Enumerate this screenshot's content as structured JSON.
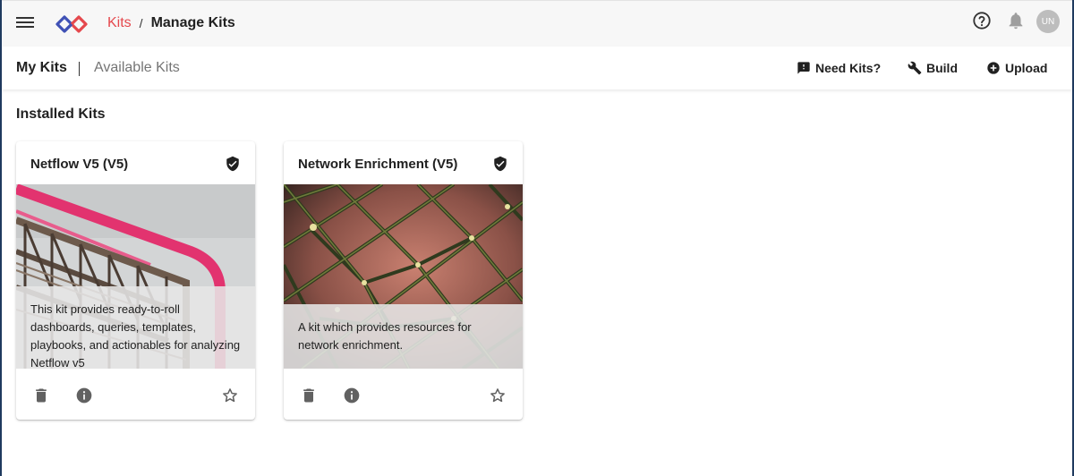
{
  "header": {
    "breadcrumb": {
      "parent": "Kits",
      "separator": "/",
      "current": "Manage Kits"
    },
    "avatar_initials": "UN",
    "icons": [
      "menu-icon",
      "help-icon",
      "bell-icon"
    ]
  },
  "subnav": {
    "tabs": [
      {
        "label": "My Kits",
        "active": true
      },
      {
        "label": "Available Kits",
        "active": false
      }
    ],
    "actions": [
      {
        "label": "Need Kits?",
        "icon": "feedback-icon"
      },
      {
        "label": "Build",
        "icon": "wrench-icon"
      },
      {
        "label": "Upload",
        "icon": "add-circle-icon"
      }
    ]
  },
  "main": {
    "section_title": "Installed Kits",
    "kits": [
      {
        "title": "Netflow V5 (V5)",
        "description": "This kit provides ready-to-roll dashboards, queries, templates, playbooks, and actionables for analyzing Netflow v5",
        "verified": true,
        "image": "industrial-pipes-photo"
      },
      {
        "title": "Network Enrichment (V5)",
        "description": "A kit which provides resources for network enrichment.",
        "verified": true,
        "image": "rope-net-photo"
      }
    ]
  },
  "colors": {
    "accent_red": "#e5484d",
    "logo_blue": "#3f51b5",
    "appbar_bg": "#f7f7f7",
    "icon_grey": "#616161"
  }
}
